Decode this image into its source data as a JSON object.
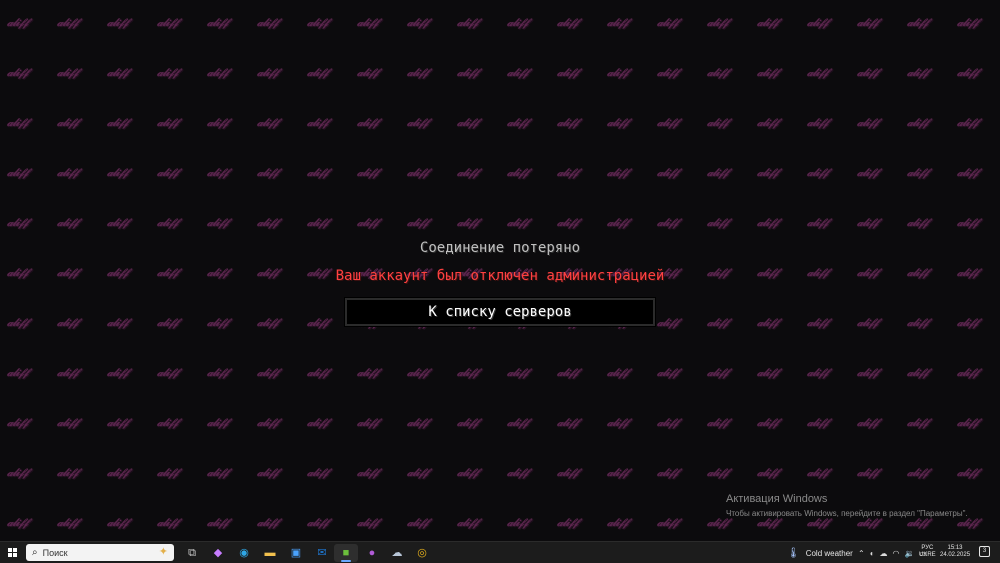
{
  "background": {
    "watermark_text": "𝒶𝓁𝒾𝒻𝒻",
    "watermark_color": "#6a2a5a",
    "base_color": "#0c0b0d"
  },
  "dialog": {
    "title": "Соединение потеряно",
    "reason": "Ваш аккаунт был отключен администрацией",
    "back_button": "К списку серверов",
    "reason_color": "#ff4141"
  },
  "activation": {
    "title": "Активация Windows",
    "subtitle": "Чтобы активировать Windows, перейдите в раздел \"Параметры\"."
  },
  "taskbar": {
    "search_placeholder": "Поиск",
    "apps": [
      {
        "name": "task-view",
        "icon": "task-view-icon",
        "glyph": "⧉",
        "color": "#cfcfcf"
      },
      {
        "name": "copilot",
        "icon": "copilot-icon",
        "glyph": "◆",
        "color": "#c77dff"
      },
      {
        "name": "edge",
        "icon": "edge-icon",
        "glyph": "◉",
        "color": "#2fa7e6"
      },
      {
        "name": "file-explorer",
        "icon": "folder-icon",
        "glyph": "▬",
        "color": "#f2c14e"
      },
      {
        "name": "store",
        "icon": "store-icon",
        "glyph": "▣",
        "color": "#4aa3ff"
      },
      {
        "name": "outlook",
        "icon": "outlook-icon",
        "glyph": "✉",
        "color": "#1f7ad6"
      },
      {
        "name": "minecraft",
        "icon": "minecraft-icon",
        "glyph": "■",
        "color": "#6cbf3c"
      },
      {
        "name": "app-purple",
        "icon": "app-circle-icon",
        "glyph": "●",
        "color": "#b05bd6"
      },
      {
        "name": "app-weather",
        "icon": "app-cloud-icon",
        "glyph": "☁",
        "color": "#b8c6d8"
      },
      {
        "name": "chrome",
        "icon": "chrome-icon",
        "glyph": "◎",
        "color": "#e8b21c"
      }
    ],
    "weather": "Cold weather",
    "language_top": "РУС",
    "language_bottom": "UKRE",
    "time": "15:13",
    "date": "24.02.2025",
    "notification_count": "3"
  }
}
